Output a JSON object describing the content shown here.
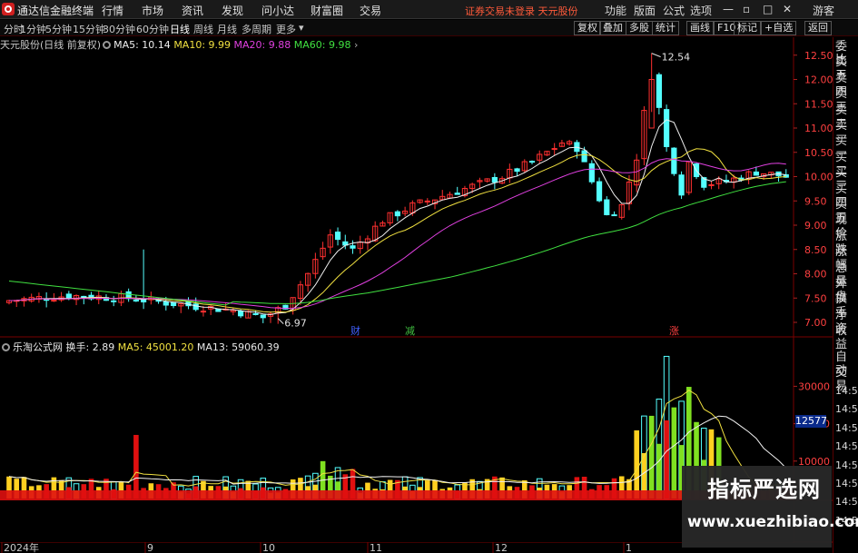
{
  "titlebar": {
    "app_title": "通达信金融终端",
    "menu": [
      "行情",
      "市场",
      "资讯",
      "发现",
      "问小达",
      "财富圈",
      "交易"
    ],
    "trade_status": "证券交易未登录",
    "stock_name": "天元股份",
    "right_menu": [
      "功能",
      "版面",
      "公式",
      "选项"
    ],
    "guest_label": "游客"
  },
  "toolbar": {
    "periods": [
      "分时",
      "1分钟",
      "5分钟",
      "15分钟",
      "30分钟",
      "60分钟",
      "日线",
      "周线",
      "月线",
      "多周期",
      "更多"
    ],
    "active_period": "日线",
    "right_buttons": [
      "复权",
      "叠加",
      "多股",
      "统计",
      "画线",
      "F10",
      "标记",
      "+自选",
      "返回"
    ]
  },
  "main_chart": {
    "title": "天元股份(日线 前复权)",
    "ma5_label": "MA5: 10.14",
    "ma10_label": "MA10: 9.99",
    "ma20_label": "MA20: 9.88",
    "ma60_label": "MA60: 9.98",
    "price_axis": [
      "12.50",
      "12.00",
      "11.50",
      "11.00",
      "10.50",
      "10.00",
      "9.50",
      "9.00",
      "8.50",
      "8.00",
      "7.50",
      "7.00"
    ],
    "high_marker": "12.54",
    "low_marker": "6.97",
    "event_markers": [
      "财",
      "减",
      "涨"
    ]
  },
  "volume_chart": {
    "title": "乐淘公式网",
    "turnover": "换手: 2.89",
    "ma5": "MA5: 45001.20",
    "ma13": "MA13: 59060.39",
    "axis": [
      "30000",
      "20000",
      "10000"
    ],
    "latest": "12577"
  },
  "date_axis": [
    "2024年",
    "9",
    "10",
    "11",
    "12",
    "1"
  ],
  "side_panel": {
    "quote_labels": [
      "委比",
      "卖五",
      "卖四",
      "卖三",
      "卖二",
      "卖一",
      "买一",
      "买二",
      "买三",
      "买四",
      "买五",
      "现价",
      "涨跌",
      "涨幅",
      "总量",
      "外盘",
      "换手",
      "净资",
      "收益"
    ],
    "trade_labels": [
      "自动",
      "交易"
    ],
    "times": [
      "14:55",
      "14:55",
      "14:55",
      "14:56",
      "14:56",
      "14:56",
      "14:56",
      "14:56"
    ]
  },
  "colors": {
    "up": "#ff3030",
    "down": "#54ffff",
    "ma5": "#f0f0f0",
    "ma10": "#f0e040",
    "ma20": "#e040e0",
    "ma60": "#40e040",
    "vol_red": "#e01010",
    "vol_yellow": "#ffd020",
    "vol_green": "#80e020"
  },
  "watermark": {
    "title": "指标严选网",
    "url": "www.xuezhibiao.com"
  }
}
